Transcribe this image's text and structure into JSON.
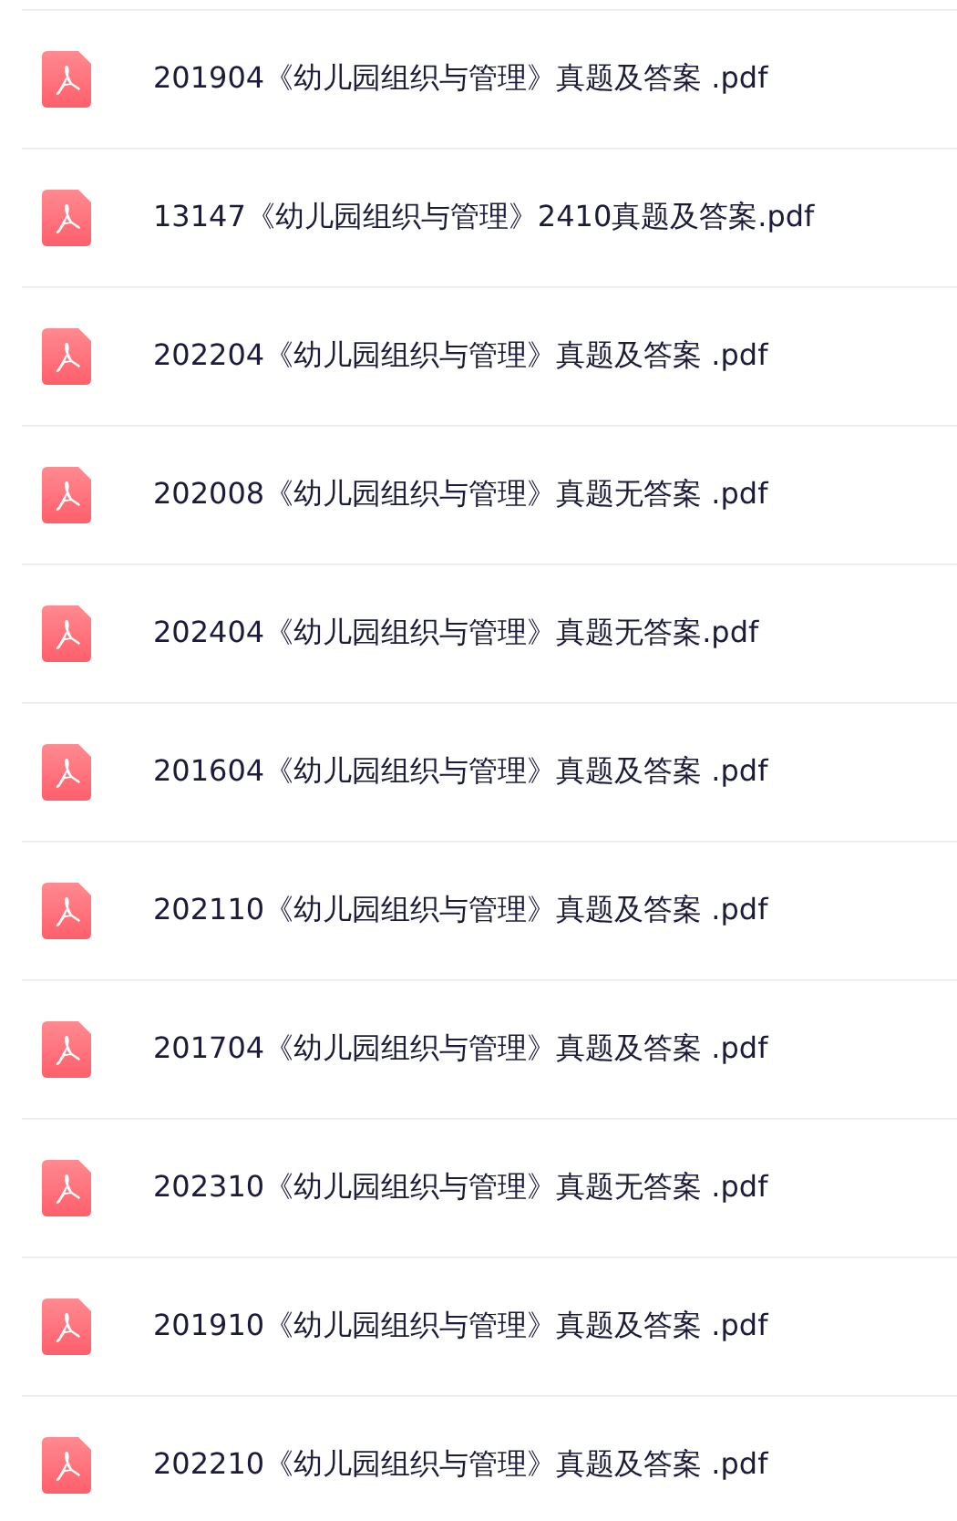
{
  "files": [
    {
      "name": "201904《幼儿园组织与管理》真题及答案 .pdf"
    },
    {
      "name": "13147《幼儿园组织与管理》2410真题及答案.pdf"
    },
    {
      "name": "202204《幼儿园组织与管理》真题及答案 .pdf"
    },
    {
      "name": "202008《幼儿园组织与管理》真题无答案 .pdf"
    },
    {
      "name": "202404《幼儿园组织与管理》真题无答案.pdf"
    },
    {
      "name": "201604《幼儿园组织与管理》真题及答案 .pdf"
    },
    {
      "name": "202110《幼儿园组织与管理》真题及答案 .pdf"
    },
    {
      "name": "201704《幼儿园组织与管理》真题及答案 .pdf"
    },
    {
      "name": "202310《幼儿园组织与管理》真题无答案 .pdf"
    },
    {
      "name": "201910《幼儿园组织与管理》真题及答案 .pdf"
    },
    {
      "name": "202210《幼儿园组织与管理》真题及答案 .pdf"
    }
  ]
}
